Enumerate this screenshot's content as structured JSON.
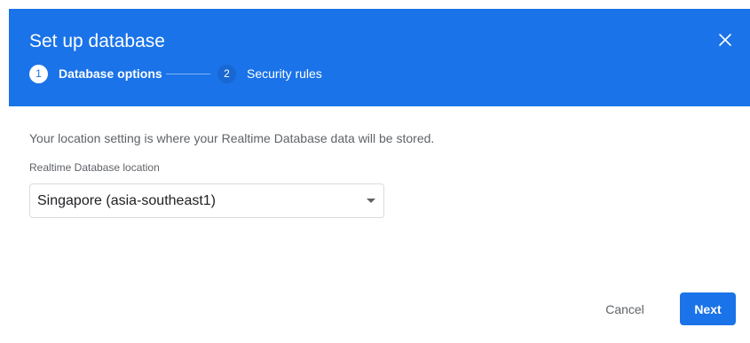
{
  "dialog": {
    "title": "Set up database",
    "close_icon": "close-icon"
  },
  "stepper": {
    "steps": [
      {
        "number": "1",
        "label": "Database options",
        "state": "active"
      },
      {
        "number": "2",
        "label": "Security rules",
        "state": "upcoming"
      }
    ]
  },
  "body": {
    "description": "Your location setting is where your Realtime Database data will be stored.",
    "location_field": {
      "label": "Realtime Database location",
      "selected_value": "Singapore (asia-southeast1)",
      "arrow_icon": "dropdown-arrow-icon"
    }
  },
  "actions": {
    "cancel_label": "Cancel",
    "next_label": "Next"
  },
  "colors": {
    "header_background": "#1a73e8",
    "primary_button": "#1a73e8",
    "secondary_text": "#5f6368"
  }
}
